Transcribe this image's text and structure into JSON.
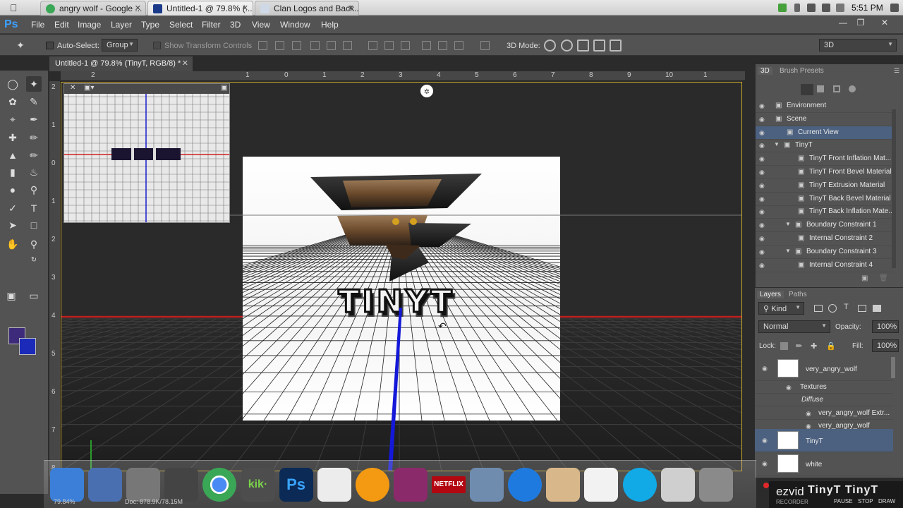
{
  "browser_tabs": [
    {
      "label": "angry wolf - Google ...",
      "icon": "chrome-icon",
      "color": "#3aa757"
    },
    {
      "label": "Untitled-1 @ 79.8% (...",
      "icon": "photoshop-icon",
      "color": "#1b3b8a"
    },
    {
      "label": "Clan Logos and Back...",
      "icon": "page-icon",
      "color": "#cfd8e6"
    }
  ],
  "clock": "5:51 PM",
  "menu": [
    "File",
    "Edit",
    "Image",
    "Layer",
    "Type",
    "Select",
    "Filter",
    "3D",
    "View",
    "Window",
    "Help"
  ],
  "app_logo": "Ps",
  "options": {
    "auto_select_label": "Auto-Select:",
    "auto_select_value": "Group",
    "show_transform_label": "Show Transform Controls",
    "mode_3d_label": "3D Mode:",
    "workspace": "3D"
  },
  "document": {
    "tab_title": "Untitled-1 @ 79.8% (TinyT, RGB/8) *",
    "zoom": "79.84%",
    "doc_info": "Doc: 878.9K/78.15M",
    "ruler_top": [
      "2",
      "1",
      "0",
      "1",
      "2",
      "3",
      "4",
      "5",
      "6",
      "7",
      "8",
      "9",
      "10",
      "1"
    ],
    "ruler_left": [
      "2",
      "1",
      "0",
      "1",
      "2",
      "3",
      "4",
      "5",
      "6",
      "7",
      "8"
    ],
    "text_3d": "TINYT"
  },
  "panel_3d": {
    "tabs": [
      "3D",
      "Brush Presets"
    ],
    "rows": [
      {
        "label": "Environment",
        "indent": 0,
        "selected": false
      },
      {
        "label": "Scene",
        "indent": 0,
        "selected": false
      },
      {
        "label": "Current View",
        "indent": 1,
        "selected": true
      },
      {
        "label": "TinyT",
        "indent": 0,
        "selected": false
      },
      {
        "label": "TinyT Front Inflation Mat...",
        "indent": 2,
        "selected": false
      },
      {
        "label": "TinyT Front Bevel Material",
        "indent": 2,
        "selected": false
      },
      {
        "label": "TinyT Extrusion Material",
        "indent": 2,
        "selected": false
      },
      {
        "label": "TinyT Back Bevel Material",
        "indent": 2,
        "selected": false
      },
      {
        "label": "TinyT Back Inflation Mate...",
        "indent": 2,
        "selected": false
      },
      {
        "label": "Boundary Constraint 1",
        "indent": 1,
        "selected": false
      },
      {
        "label": "Internal Constraint 2",
        "indent": 2,
        "selected": false
      },
      {
        "label": "Boundary Constraint 3",
        "indent": 1,
        "selected": false
      },
      {
        "label": "Internal Constraint 4",
        "indent": 2,
        "selected": false
      }
    ]
  },
  "layers": {
    "tabs": [
      "Layers",
      "Paths"
    ],
    "kind": "Kind",
    "blend": "Normal",
    "opacity_label": "Opacity:",
    "opacity": "100%",
    "lock_label": "Lock:",
    "fill_label": "Fill:",
    "fill": "100%",
    "items": [
      {
        "label": "very_angry_wolf",
        "type": "layer",
        "selected": false
      },
      {
        "label": "Textures",
        "type": "sub",
        "selected": false
      },
      {
        "label": "Diffuse",
        "type": "sub2",
        "selected": false
      },
      {
        "label": "very_angry_wolf Extr...",
        "type": "sub3",
        "selected": false
      },
      {
        "label": "very_angry_wolf",
        "type": "sub3",
        "selected": false
      },
      {
        "label": "TinyT",
        "type": "layer",
        "selected": true
      },
      {
        "label": "white",
        "type": "layer",
        "selected": false
      }
    ]
  },
  "dock": [
    {
      "name": "finder-icon",
      "label": "",
      "color": "#3b7fd9"
    },
    {
      "name": "imovie-icon",
      "label": "",
      "color": "#4a6fb0"
    },
    {
      "name": "launchpad-icon",
      "label": "",
      "color": "#777"
    },
    {
      "name": "camera-icon",
      "label": "",
      "color": "#444"
    },
    {
      "name": "chrome-icon",
      "label": "",
      "color": "#3aa757"
    },
    {
      "name": "kik-icon",
      "label": "kik·",
      "color": "#4d4d4d"
    },
    {
      "name": "photoshop-icon",
      "label": "Ps",
      "color": "#0b2a55"
    },
    {
      "name": "textedit-icon",
      "label": "",
      "color": "#ececec"
    },
    {
      "name": "vlc-icon",
      "label": "",
      "color": "#f39a12"
    },
    {
      "name": "winrar-icon",
      "label": "",
      "color": "#8b2a6a"
    },
    {
      "name": "netflix-icon",
      "label": "NETFLIX",
      "color": "#b20710"
    },
    {
      "name": "iphoto-icon",
      "label": "",
      "color": "#6f8caf"
    },
    {
      "name": "itunes-icon",
      "label": "",
      "color": "#1f7ae0"
    },
    {
      "name": "home-icon",
      "label": "",
      "color": "#d8b88a"
    },
    {
      "name": "document-icon",
      "label": "",
      "color": "#f2f2f2"
    },
    {
      "name": "skype-icon",
      "label": "",
      "color": "#11a9e6"
    },
    {
      "name": "apple-tv-icon",
      "label": "",
      "color": "#cfcfcf"
    },
    {
      "name": "system-preferences-icon",
      "label": "",
      "color": "#8a8a8a"
    }
  ],
  "recorder": {
    "logo": "ezvid",
    "sub": "RECORDER",
    "buttons": [
      "PAUSE",
      "STOP",
      "DRAW"
    ],
    "overlay": "TinyT TinyT"
  }
}
